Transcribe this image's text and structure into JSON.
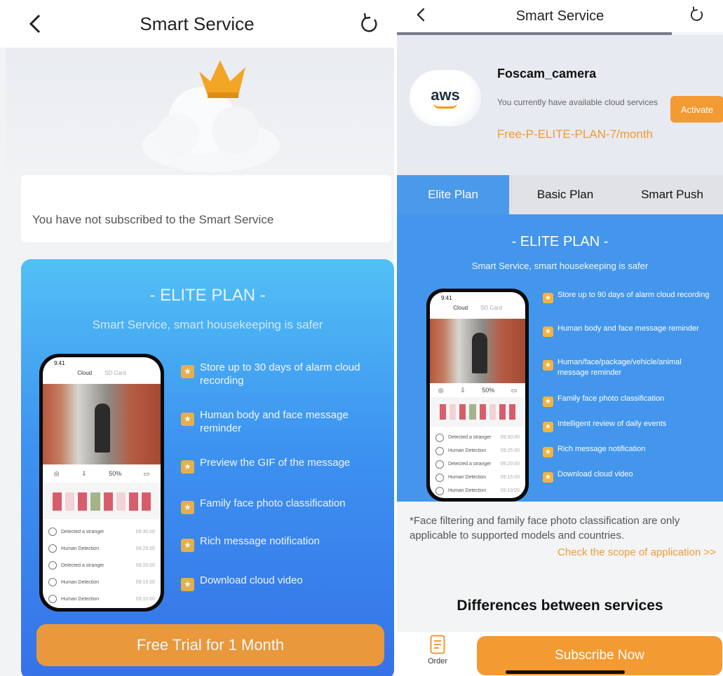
{
  "left": {
    "header": {
      "title": "Smart Service"
    },
    "status": {
      "text": "You have not subscribed to the Smart Service"
    },
    "plan": {
      "title": "- ELITE PLAN -",
      "subtitle": "Smart Service, smart housekeeping is safer",
      "features": [
        "Store up to 30 days of alarm cloud recording",
        "Human body and face message reminder",
        "Preview the GIF of the message",
        "Family face photo classification",
        "Rich message notification",
        "Download cloud video"
      ]
    },
    "cta": {
      "label": "Free Trial for 1 Month"
    }
  },
  "right": {
    "header": {
      "title": "Smart Service"
    },
    "device": {
      "logo_text": "aws",
      "name": "Foscam_camera",
      "description": "You currently have available cloud services",
      "plan": "Free-P-ELITE-PLAN-7/month",
      "activate_label": "Activate"
    },
    "tabs": [
      {
        "label": "Elite Plan",
        "active": true
      },
      {
        "label": "Basic Plan",
        "active": false
      },
      {
        "label": "Smart Push",
        "active": false
      }
    ],
    "plan": {
      "title": "- ELITE PLAN -",
      "subtitle": "Smart Service, smart housekeeping is safer",
      "features": [
        "Store up to 90 days of alarm cloud recording",
        "Human body and face message reminder",
        "Human/face/package/vehicle/animal message reminder",
        "Family face photo classification",
        "Intelligent review of daily events",
        "Rich message notification",
        "Download cloud video"
      ]
    },
    "note": "*Face filtering and family face photo classification are only applicable to supported models and countries.",
    "scope_link": "Check the scope of application >>",
    "differences_title": "Differences between services",
    "bottom": {
      "order_label": "Order",
      "subscribe_label": "Subscribe Now"
    }
  },
  "phone_mock": {
    "time": "9:41",
    "tabs": [
      "Cloud",
      "SD Card"
    ],
    "controls": [
      "◎",
      "⇩",
      "50%",
      "▭"
    ],
    "events": [
      {
        "label": "Detected a stranger",
        "time": "09:30:00"
      },
      {
        "label": "Human Detection",
        "time": "09:25:00"
      },
      {
        "label": "Detected a stranger",
        "time": "09:20:00"
      },
      {
        "label": "Human Detection",
        "time": "09:15:00"
      },
      {
        "label": "Human Detection",
        "time": "09:10:00"
      }
    ]
  },
  "colors": {
    "accent": "#f39a33",
    "plan_blue": "#4396eb",
    "star": "#f3b33d"
  },
  "icons": [
    "back-chevron-icon",
    "refresh-icon",
    "crown-icon",
    "cloud-icon",
    "star-icon",
    "order-icon"
  ]
}
